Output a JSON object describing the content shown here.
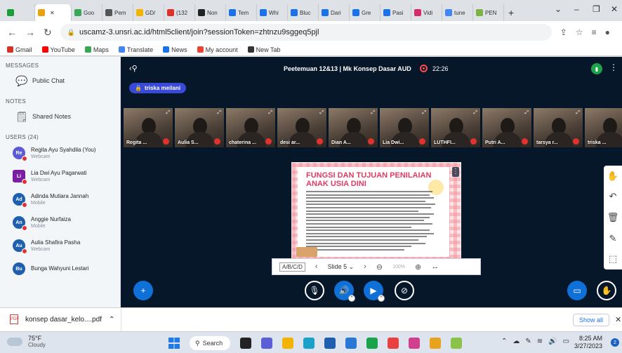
{
  "browser": {
    "tabs": [
      {
        "label": "",
        "color": "#1a9f3a"
      },
      {
        "label": "",
        "color": "#e8a20c",
        "active": true
      },
      {
        "label": "Goo",
        "color": "#3aa757"
      },
      {
        "label": "Pem",
        "color": "#555555"
      },
      {
        "label": "GD/",
        "color": "#f2b400"
      },
      {
        "label": "(132",
        "color": "#e0312b"
      },
      {
        "label": "Non",
        "color": "#222222"
      },
      {
        "label": "Tem",
        "color": "#1a73e8"
      },
      {
        "label": "Whi",
        "color": "#1a73e8"
      },
      {
        "label": "Bluc",
        "color": "#1a73e8"
      },
      {
        "label": "Dari",
        "color": "#1a73e8"
      },
      {
        "label": "Gre",
        "color": "#1a73e8"
      },
      {
        "label": "Pasi",
        "color": "#1a73e8"
      },
      {
        "label": "Vidi",
        "color": "#d72c6c"
      },
      {
        "label": "tune",
        "color": "#4285f4"
      },
      {
        "label": "PEN",
        "color": "#7cb342"
      }
    ],
    "new_tab_symbol": "+",
    "url": "uscamz-3.unsri.ac.id/html5client/join?sessionToken=zhtnzu9sggeq5pjl",
    "bookmarks": [
      {
        "label": "Gmail",
        "color": "#d93025"
      },
      {
        "label": "YouTube",
        "color": "#ff0000"
      },
      {
        "label": "Maps",
        "color": "#34a853"
      },
      {
        "label": "Translate",
        "color": "#4285f4"
      },
      {
        "label": "News",
        "color": "#1a73e8"
      },
      {
        "label": "My account",
        "color": "#ea4335"
      },
      {
        "label": "New Tab",
        "color": "#333333"
      }
    ]
  },
  "sidebar": {
    "messages_header": "MESSAGES",
    "public_chat": "Public Chat",
    "notes_header": "NOTES",
    "shared_notes": "Shared Notes",
    "users_header": "USERS (24)",
    "users": [
      {
        "initials": "Re",
        "name": "Regita Ayu Syahdila (You)",
        "status": "Webcam",
        "color": "#5b5bd6",
        "square": false
      },
      {
        "initials": "Li",
        "name": "Lia Dwi Ayu Pagarwati",
        "status": "Webcam",
        "color": "#7b1fa2",
        "square": true
      },
      {
        "initials": "Ad",
        "name": "Adinda Mutiara Jannah",
        "status": "Mobile",
        "color": "#1e5fb0",
        "square": false
      },
      {
        "initials": "An",
        "name": "Anggie Nurfaiza",
        "status": "Mobile",
        "color": "#1e5fb0",
        "square": false
      },
      {
        "initials": "Au",
        "name": "Aulia Shafira Pasha",
        "status": "Webcam",
        "color": "#1e5fb0",
        "square": false
      },
      {
        "initials": "Bu",
        "name": "Bunga Wahyuni Lestari",
        "status": "",
        "color": "#1e5fb0",
        "square": false
      }
    ]
  },
  "meeting": {
    "title": "Peetemuan 12&13 | Mk Konsep Dasar AUD",
    "recording_time": "22:26",
    "presenter": "triska meilani",
    "videos": [
      "Regita ...",
      "Aulia S...",
      "chaterina ...",
      "desi ar...",
      "Dian A...",
      "Lia Dwi...",
      "LUTHFI...",
      "Putri A...",
      "tarsya r...",
      "triska ..."
    ],
    "slide": {
      "title": "FUNGSI DAN TUJUAN PENILAIAN ANAK USIA DINI"
    },
    "slide_controls": {
      "abcd": "A/B/C/D",
      "prev": "‹",
      "slide_label": "Slide 5",
      "next": "›",
      "zoom": "100%"
    }
  },
  "downloads": {
    "file": "konsep dasar_kelo....pdf",
    "show_all": "Show all"
  },
  "taskbar": {
    "temperature": "75°F",
    "condition": "Cloudy",
    "search": "Search",
    "time": "8:25 AM",
    "date": "3/27/2023",
    "notifications": "2"
  }
}
